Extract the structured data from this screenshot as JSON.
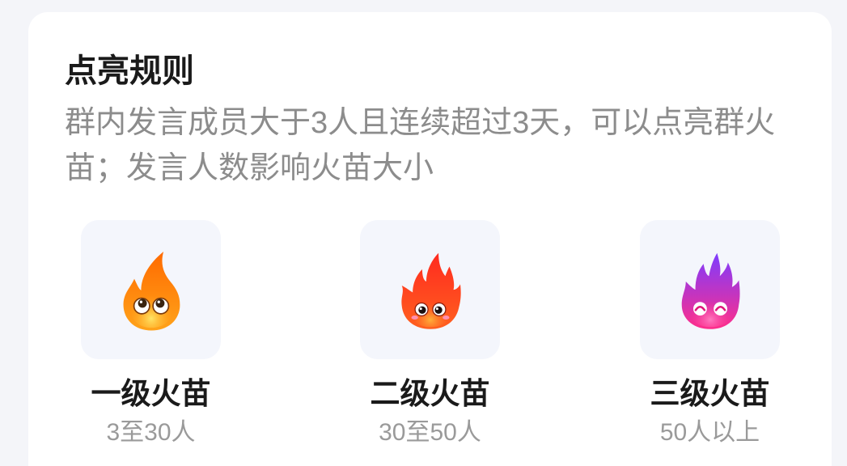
{
  "rules": {
    "title": "点亮规则",
    "description": "群内发言成员大于3人且连续超过3天，可以点亮群火苗；发言人数影响火苗大小"
  },
  "levels": [
    {
      "name": "一级火苗",
      "range": "3至30人",
      "icon": "orange-flame-icon",
      "colors": {
        "top": "#ff6a00",
        "bottom": "#ffa31a",
        "core": "#ffe566"
      }
    },
    {
      "name": "二级火苗",
      "range": "30至50人",
      "icon": "red-flame-icon",
      "colors": {
        "top": "#ff2a1f",
        "bottom": "#ff601f",
        "core": "#ffb03a"
      }
    },
    {
      "name": "三级火苗",
      "range": "50人以上",
      "icon": "purple-flame-icon",
      "colors": {
        "top": "#7d3cff",
        "bottom": "#ff2e8a",
        "core": "#ff7ac0"
      }
    }
  ]
}
